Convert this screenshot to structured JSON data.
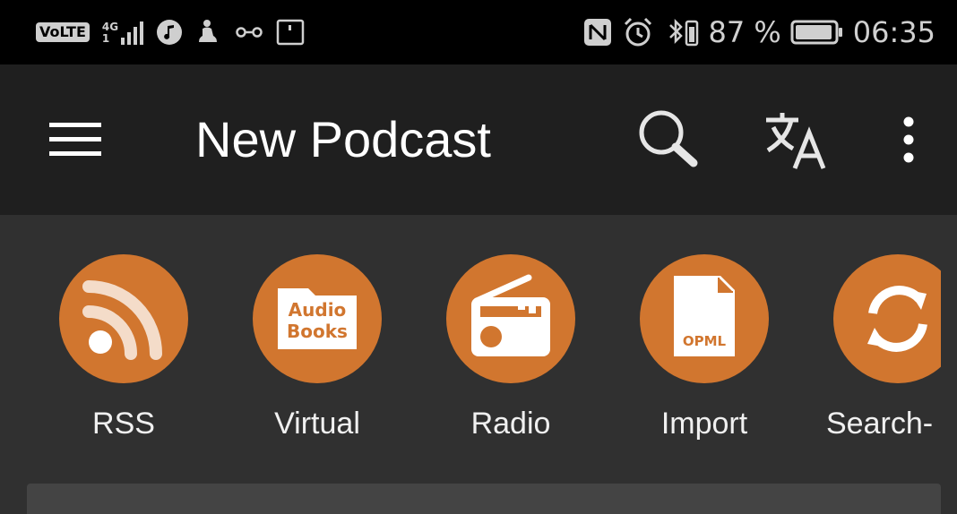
{
  "status_bar": {
    "volte": "VoLTE",
    "network_top": "4G",
    "network_bottom": "1",
    "battery_percent": "87 %",
    "time": "06:35"
  },
  "app_bar": {
    "title": "New Podcast",
    "icons": [
      "menu-icon",
      "search-icon",
      "translate-icon",
      "more-vert-icon"
    ]
  },
  "shortcuts": [
    {
      "label": "RSS",
      "icon": "rss-icon"
    },
    {
      "label": "Virtual",
      "icon": "audio-books-folder-icon",
      "icon_text_1": "Audio",
      "icon_text_2": "Books"
    },
    {
      "label": "Radio",
      "icon": "radio-icon"
    },
    {
      "label": "Import",
      "icon": "opml-file-icon",
      "icon_text": "OPML"
    },
    {
      "label": "Search-",
      "icon": "sync-icon"
    }
  ],
  "colors": {
    "accent": "#d1762f",
    "app_bar_bg": "#1f1f1f",
    "content_bg": "#303030",
    "status_bar_bg": "#000000"
  }
}
